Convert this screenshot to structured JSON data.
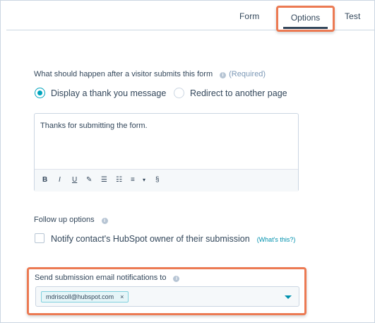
{
  "tabs": [
    {
      "label": "Form"
    },
    {
      "label": "Options"
    },
    {
      "label": "Test"
    }
  ],
  "after_submit": {
    "label": "What should happen after a visitor submits this form",
    "required": "(Required)",
    "options": [
      {
        "label": "Display a thank you message",
        "selected": true
      },
      {
        "label": "Redirect to another page",
        "selected": false
      }
    ]
  },
  "editor": {
    "text": "Thanks for submitting the form.",
    "toolbar": {
      "bold": "B",
      "italic": "I",
      "underline": "U",
      "clear": "✎",
      "bullet_list": "☰",
      "numbered_list": "☷",
      "align": "≡",
      "align_caret": "▾",
      "link": "§"
    }
  },
  "follow_up": {
    "label": "Follow up options",
    "checkbox_label": "Notify contact's HubSpot owner of their submission",
    "whats_this": "(What's this?)"
  },
  "notifications": {
    "label": "Send submission email notifications to",
    "emails": [
      "mdriscoll@hubspot.com"
    ],
    "remove_glyph": "×"
  },
  "colors": {
    "accent_teal": "#00a4bd",
    "highlight_orange": "#ec7a53",
    "text": "#33475b",
    "link": "#0091ae"
  }
}
